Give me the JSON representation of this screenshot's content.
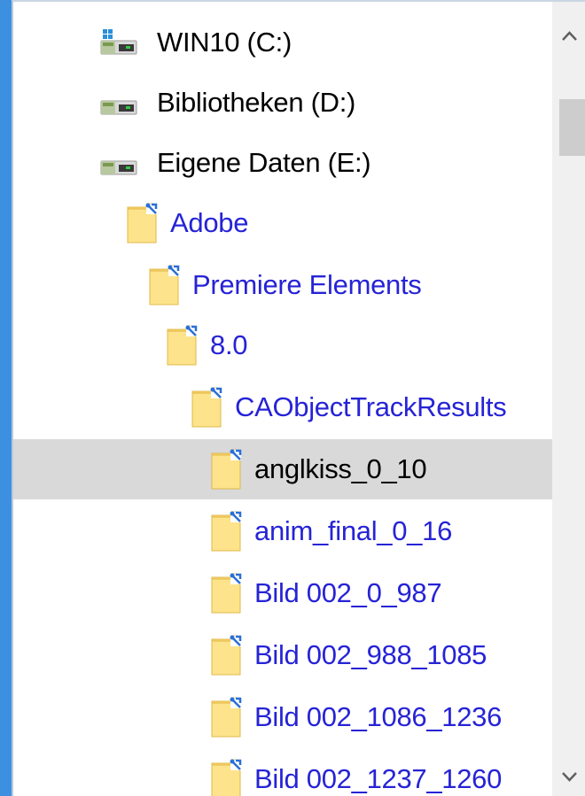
{
  "tree": {
    "items": [
      {
        "label": "WIN10 (C:)",
        "kind": "drive",
        "icon": "windows-drive-icon",
        "selected": false
      },
      {
        "label": "Bibliotheken (D:)",
        "kind": "drive",
        "icon": "drive-icon",
        "selected": false
      },
      {
        "label": "Eigene Daten (E:)",
        "kind": "drive",
        "icon": "drive-icon",
        "selected": false
      },
      {
        "label": "Adobe",
        "kind": "folder",
        "icon": "folder-icon",
        "selected": false
      },
      {
        "label": "Premiere Elements",
        "kind": "folder",
        "icon": "folder-icon",
        "selected": false
      },
      {
        "label": "8.0",
        "kind": "folder",
        "icon": "folder-icon",
        "selected": false
      },
      {
        "label": "CAObjectTrackResults",
        "kind": "folder",
        "icon": "folder-icon",
        "selected": false
      },
      {
        "label": "anglkiss_0_10",
        "kind": "folder",
        "icon": "folder-icon",
        "selected": true
      },
      {
        "label": "anim_final_0_16",
        "kind": "folder",
        "icon": "folder-icon",
        "selected": false
      },
      {
        "label": "Bild 002_0_987",
        "kind": "folder",
        "icon": "folder-icon",
        "selected": false
      },
      {
        "label": "Bild 002_988_1085",
        "kind": "folder",
        "icon": "folder-icon",
        "selected": false
      },
      {
        "label": "Bild 002_1086_1236",
        "kind": "folder",
        "icon": "folder-icon",
        "selected": false
      },
      {
        "label": "Bild 002_1237_1260",
        "kind": "folder",
        "icon": "folder-icon",
        "selected": false
      }
    ]
  },
  "scrollbar": {
    "up_icon": "chevron-up-icon",
    "down_icon": "chevron-down-icon"
  },
  "colors": {
    "window_frame": "#3d8fe0",
    "folder_text": "#2623d6",
    "selection": "#d9d9d9",
    "scroll_track": "#f0f0f0",
    "scroll_thumb": "#cdcdcd"
  }
}
